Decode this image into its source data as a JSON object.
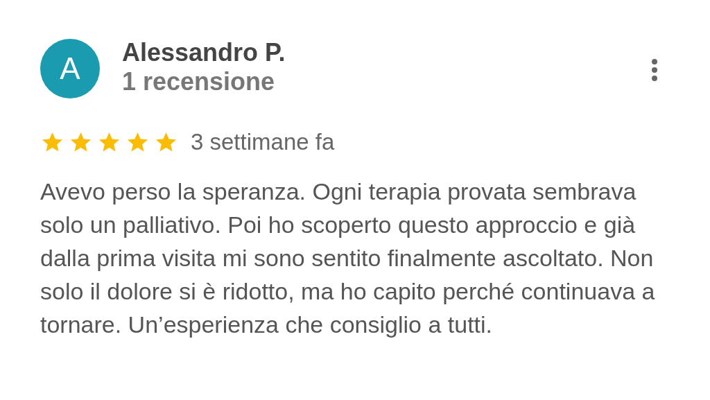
{
  "review": {
    "avatar_letter": "A",
    "author": "Alessandro P.",
    "review_count": "1 recensione",
    "stars": 5,
    "time": "3 settimane fa",
    "text": "Avevo perso la speranza. Ogni terapia provata sembrava solo un palliativo. Poi ho scoperto questo approccio e già dalla prima visita mi sono sentito finalmente ascoltato. Non solo il dolore si è ridotto, ma ho capito perché continuava a tornare. Un’esperienza che consiglio a tutti."
  }
}
